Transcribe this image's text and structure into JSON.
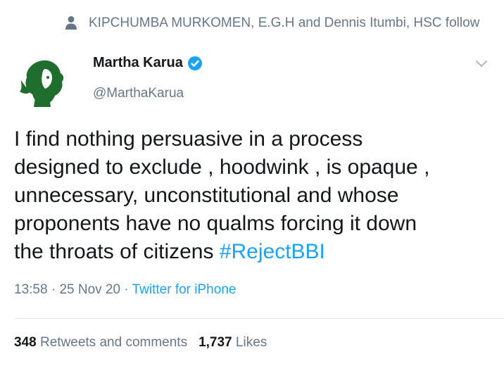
{
  "social_context": {
    "icon": "person-icon",
    "text": "KIPCHUMBA MURKOMEN, E.G.H and Dennis Itumbi, HSC follow"
  },
  "author": {
    "name": "Martha Karua",
    "handle": "@MarthaKarua",
    "verified": true,
    "avatar_icon": "avatar-silhouette"
  },
  "tweet": {
    "lines": [
      "I find nothing persuasive in a process",
      "designed to exclude , hoodwink , is opaque ,",
      "unnecessary, unconstitutional and whose",
      "proponents have no qualms forcing it down",
      "the throats of citizens "
    ],
    "hashtag": "#RejectBBI",
    "time": "13:58",
    "date": "25 Nov 20",
    "separator": " · ",
    "source": "Twitter for iPhone"
  },
  "stats": {
    "retweets_count": "348",
    "retweets_label": "Retweets and comments",
    "likes_count": "1,737",
    "likes_label": "Likes"
  },
  "colors": {
    "link": "#1da1f2",
    "secondary_text": "#657786",
    "primary_text": "#14171a",
    "avatar_green": "#1f6e2e"
  }
}
